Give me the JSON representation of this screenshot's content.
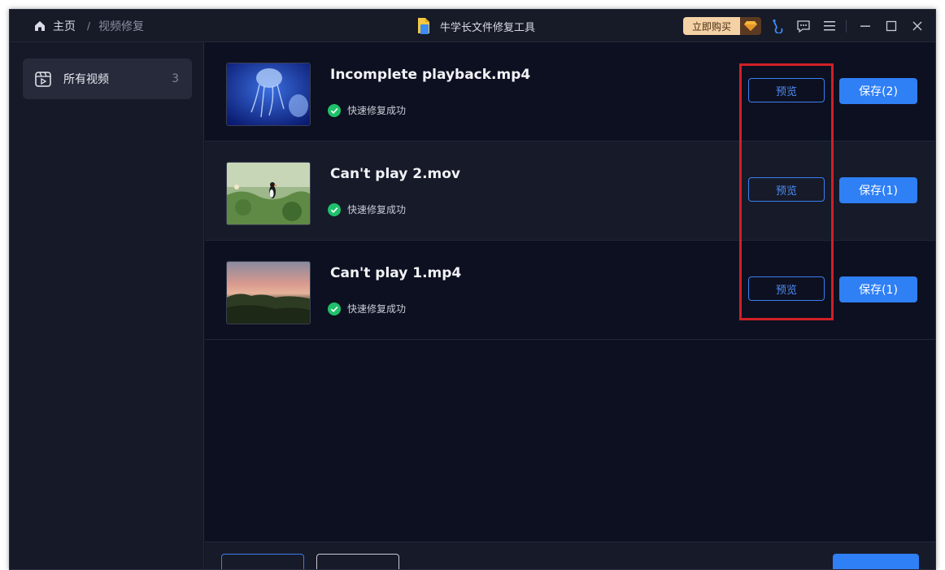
{
  "titlebar": {
    "breadcrumb_home": "主页",
    "breadcrumb_sep": "/",
    "breadcrumb_current": "视频修复",
    "app_title": "牛学长文件修复工具",
    "buy_label": "立即购买"
  },
  "sidebar": {
    "items": [
      {
        "label": "所有视频",
        "count": "3"
      }
    ]
  },
  "files": [
    {
      "name": "Incomplete playback.mp4",
      "status": "快速修复成功",
      "preview_label": "预览",
      "save_label": "保存(2)"
    },
    {
      "name": "Can't play 2.mov",
      "status": "快速修复成功",
      "preview_label": "预览",
      "save_label": "保存(1)"
    },
    {
      "name": "Can't play 1.mp4",
      "status": "快速修复成功",
      "preview_label": "预览",
      "save_label": "保存(1)"
    }
  ],
  "colors": {
    "accent": "#2f7ff5",
    "success": "#1fc06b",
    "highlight": "#d02027",
    "background": "#0d1020"
  },
  "icons": [
    "home-icon",
    "app-logo-icon",
    "gem-icon",
    "support-icon",
    "feedback-icon",
    "menu-icon",
    "minimize-icon",
    "maximize-icon",
    "close-icon",
    "video-library-icon",
    "check-circle-icon"
  ]
}
